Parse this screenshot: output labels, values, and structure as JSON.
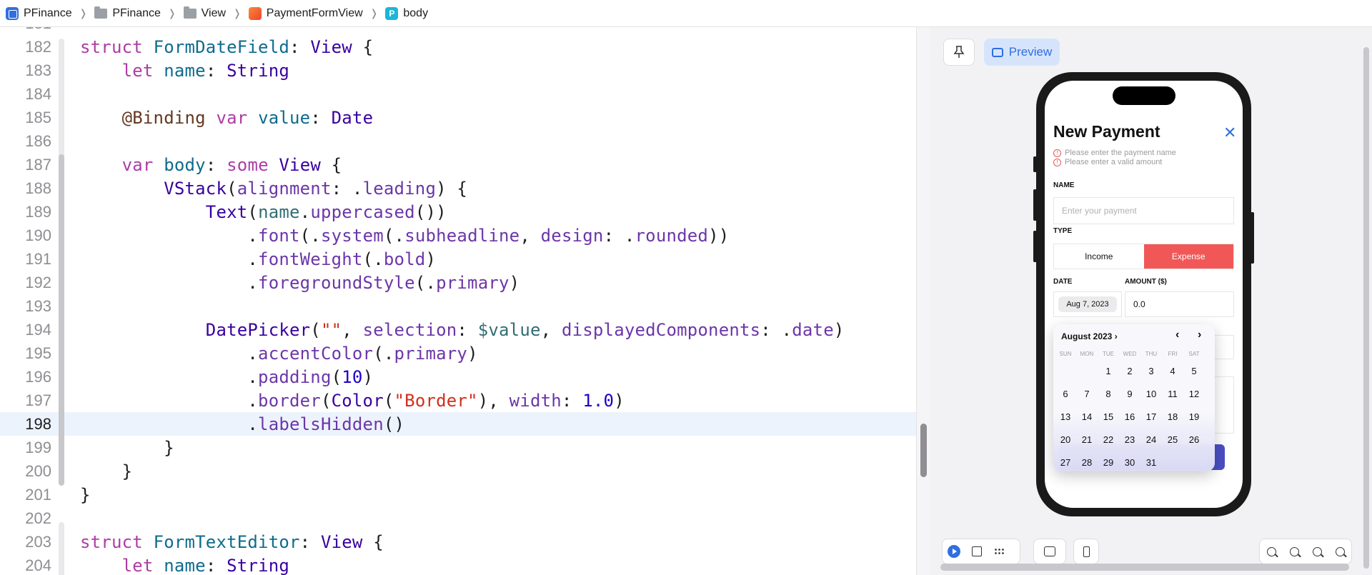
{
  "breadcrumb": {
    "items": [
      {
        "label": "PFinance",
        "icon": "app-icon"
      },
      {
        "label": "PFinance",
        "icon": "folder-icon"
      },
      {
        "label": "View",
        "icon": "folder-icon"
      },
      {
        "label": "PaymentFormView",
        "icon": "swift-file-icon"
      },
      {
        "label": "body",
        "icon": "property-icon",
        "icon_letter": "P"
      }
    ],
    "separator": "❭"
  },
  "editor": {
    "current_line": "198",
    "partial_top_line": "181",
    "lines": [
      {
        "num": "182",
        "html": "<span class=\"kw\">struct</span> <span class=\"prop\">FormDateField</span>: <span class=\"ty\">View</span> {"
      },
      {
        "num": "183",
        "html": "    <span class=\"kw\">let</span> <span class=\"prop\">name</span>: <span class=\"ty\">String</span>"
      },
      {
        "num": "184",
        "html": ""
      },
      {
        "num": "185",
        "html": "    <span class=\"at\">@Binding</span> <span class=\"kw\">var</span> <span class=\"prop\">value</span>: <span class=\"ty\">Date</span>"
      },
      {
        "num": "186",
        "html": ""
      },
      {
        "num": "187",
        "html": "    <span class=\"kw\">var</span> <span class=\"prop\">body</span>: <span class=\"kw\">some</span> <span class=\"ty\">View</span> {"
      },
      {
        "num": "188",
        "html": "        <span class=\"ty\">VStack</span>(<span class=\"fn\">alignment</span>: .<span class=\"fn\">leading</span>) {"
      },
      {
        "num": "189",
        "html": "            <span class=\"ty\">Text</span>(<span class=\"vr\">name</span>.<span class=\"fn\">uppercased</span>())"
      },
      {
        "num": "190",
        "html": "                .<span class=\"fn\">font</span>(.<span class=\"fn\">system</span>(.<span class=\"fn\">subheadline</span>, <span class=\"fn\">design</span>: .<span class=\"fn\">rounded</span>))"
      },
      {
        "num": "191",
        "html": "                .<span class=\"fn\">fontWeight</span>(.<span class=\"fn\">bold</span>)"
      },
      {
        "num": "192",
        "html": "                .<span class=\"fn\">foregroundStyle</span>(.<span class=\"fn\">primary</span>)"
      },
      {
        "num": "193",
        "html": ""
      },
      {
        "num": "194",
        "html": "            <span class=\"ty\">DatePicker</span>(<span class=\"st\">\"\"</span>, <span class=\"fn\">selection</span>: <span class=\"vr\">$value</span>, <span class=\"fn\">displayedComponents</span>: .<span class=\"fn\">date</span>)"
      },
      {
        "num": "195",
        "html": "                .<span class=\"fn\">accentColor</span>(.<span class=\"fn\">primary</span>)"
      },
      {
        "num": "196",
        "html": "                .<span class=\"fn\">padding</span>(<span class=\"nm\">10</span>)"
      },
      {
        "num": "197",
        "html": "                .<span class=\"fn\">border</span>(<span class=\"ty\">Color</span>(<span class=\"st\">\"Border\"</span>), <span class=\"fn\">width</span>: <span class=\"nm\">1.0</span>)"
      },
      {
        "num": "198",
        "html": "                .<span class=\"fn\">labelsHidden</span>()"
      },
      {
        "num": "199",
        "html": "        }"
      },
      {
        "num": "200",
        "html": "    }"
      },
      {
        "num": "201",
        "html": "}"
      },
      {
        "num": "202",
        "html": ""
      },
      {
        "num": "203",
        "html": "<span class=\"kw\">struct</span> <span class=\"prop\">FormTextEditor</span>: <span class=\"ty\">View</span> {"
      },
      {
        "num": "204",
        "html": "    <span class=\"kw\">let</span> <span class=\"prop\">name</span>: <span class=\"ty\">String</span>"
      }
    ]
  },
  "canvas": {
    "preview_label": "Preview",
    "pin_icon": "pin-icon"
  },
  "phone": {
    "title": "New Payment",
    "close_icon": "xmark-icon",
    "errors": [
      "Please enter the payment name",
      "Please enter a valid amount"
    ],
    "name_label": "NAME",
    "name_placeholder": "Enter your payment",
    "type_label": "TYPE",
    "type_options": [
      "Income",
      "Expense"
    ],
    "type_selected": "Expense",
    "date_label": "DATE",
    "date_value": "Aug 7, 2023",
    "amount_label": "AMOUNT ($)",
    "amount_value": "0.0",
    "accent_color": "#f25757",
    "button_color": "#4a4fc4"
  },
  "calendar": {
    "month": "August 2023",
    "month_chevron": "›",
    "prev": "‹",
    "next": "›",
    "weekdays": [
      "SUN",
      "MON",
      "TUE",
      "WED",
      "THU",
      "FRI",
      "SAT"
    ],
    "first_weekday_index": 2,
    "days": [
      "1",
      "2",
      "3",
      "4",
      "5",
      "6",
      "7",
      "8",
      "9",
      "10",
      "11",
      "12",
      "13",
      "14",
      "15",
      "16",
      "17",
      "18",
      "19",
      "20",
      "21",
      "22",
      "23",
      "24",
      "25",
      "26",
      "27",
      "28",
      "29",
      "30",
      "31"
    ]
  },
  "toolbar": {
    "left": [
      "live-preview-icon",
      "selectable-mode-icon",
      "grid-variants-icon"
    ],
    "middle": [
      "device-settings-icon"
    ],
    "device": [
      "device-icon"
    ],
    "zoom": [
      "zoom-out-icon",
      "zoom-to-100-icon",
      "zoom-in-icon",
      "zoom-to-fit-icon"
    ]
  }
}
